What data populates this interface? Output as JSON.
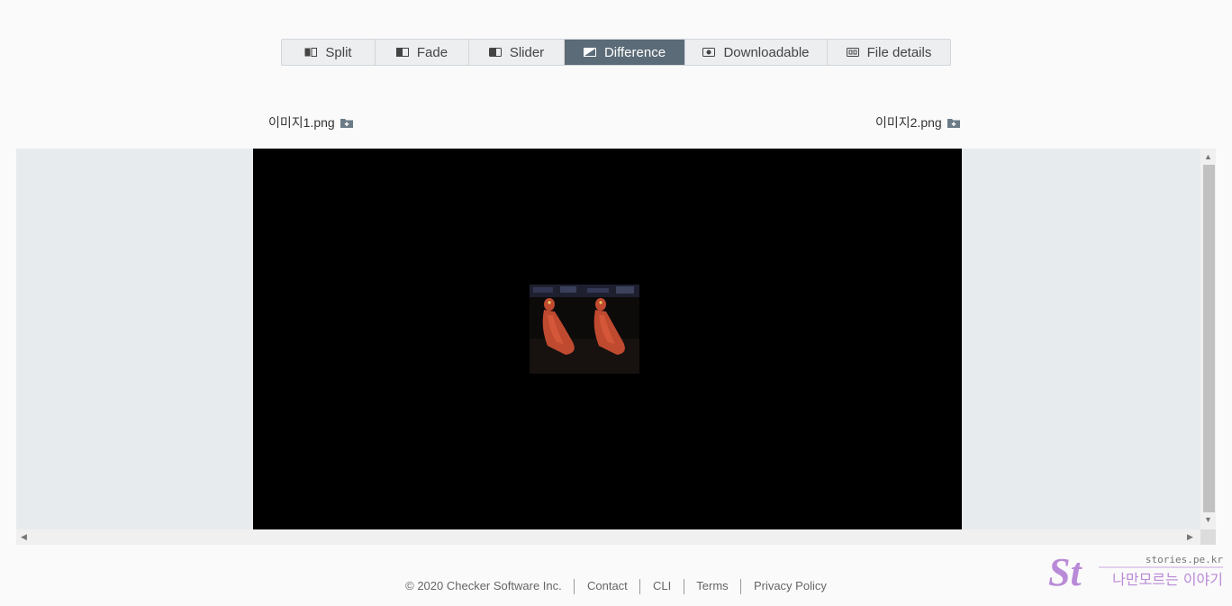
{
  "tabs": [
    {
      "label": "Split",
      "icon": "split-icon"
    },
    {
      "label": "Fade",
      "icon": "fade-icon"
    },
    {
      "label": "Slider",
      "icon": "slider-icon"
    },
    {
      "label": "Difference",
      "icon": "difference-icon",
      "active": true
    },
    {
      "label": "Downloadable",
      "icon": "downloadable-icon"
    },
    {
      "label": "File details",
      "icon": "file-details-icon"
    }
  ],
  "files": {
    "left_name": "이미지1.png",
    "right_name": "이미지2.png"
  },
  "footer": {
    "copyright": "© 2020 Checker Software Inc.",
    "links": [
      "Contact",
      "CLI",
      "Terms",
      "Privacy Policy"
    ]
  },
  "watermark": {
    "logo_text": "St",
    "site": "stories.pe.kr",
    "tagline": "나만모르는 이야기"
  },
  "colors": {
    "active_tab": "#5b6b77",
    "tab_bg": "#eceef0",
    "viewer_bg": "#e8ebee",
    "canvas_bg": "#000000",
    "watermark": "#b98ad8"
  }
}
